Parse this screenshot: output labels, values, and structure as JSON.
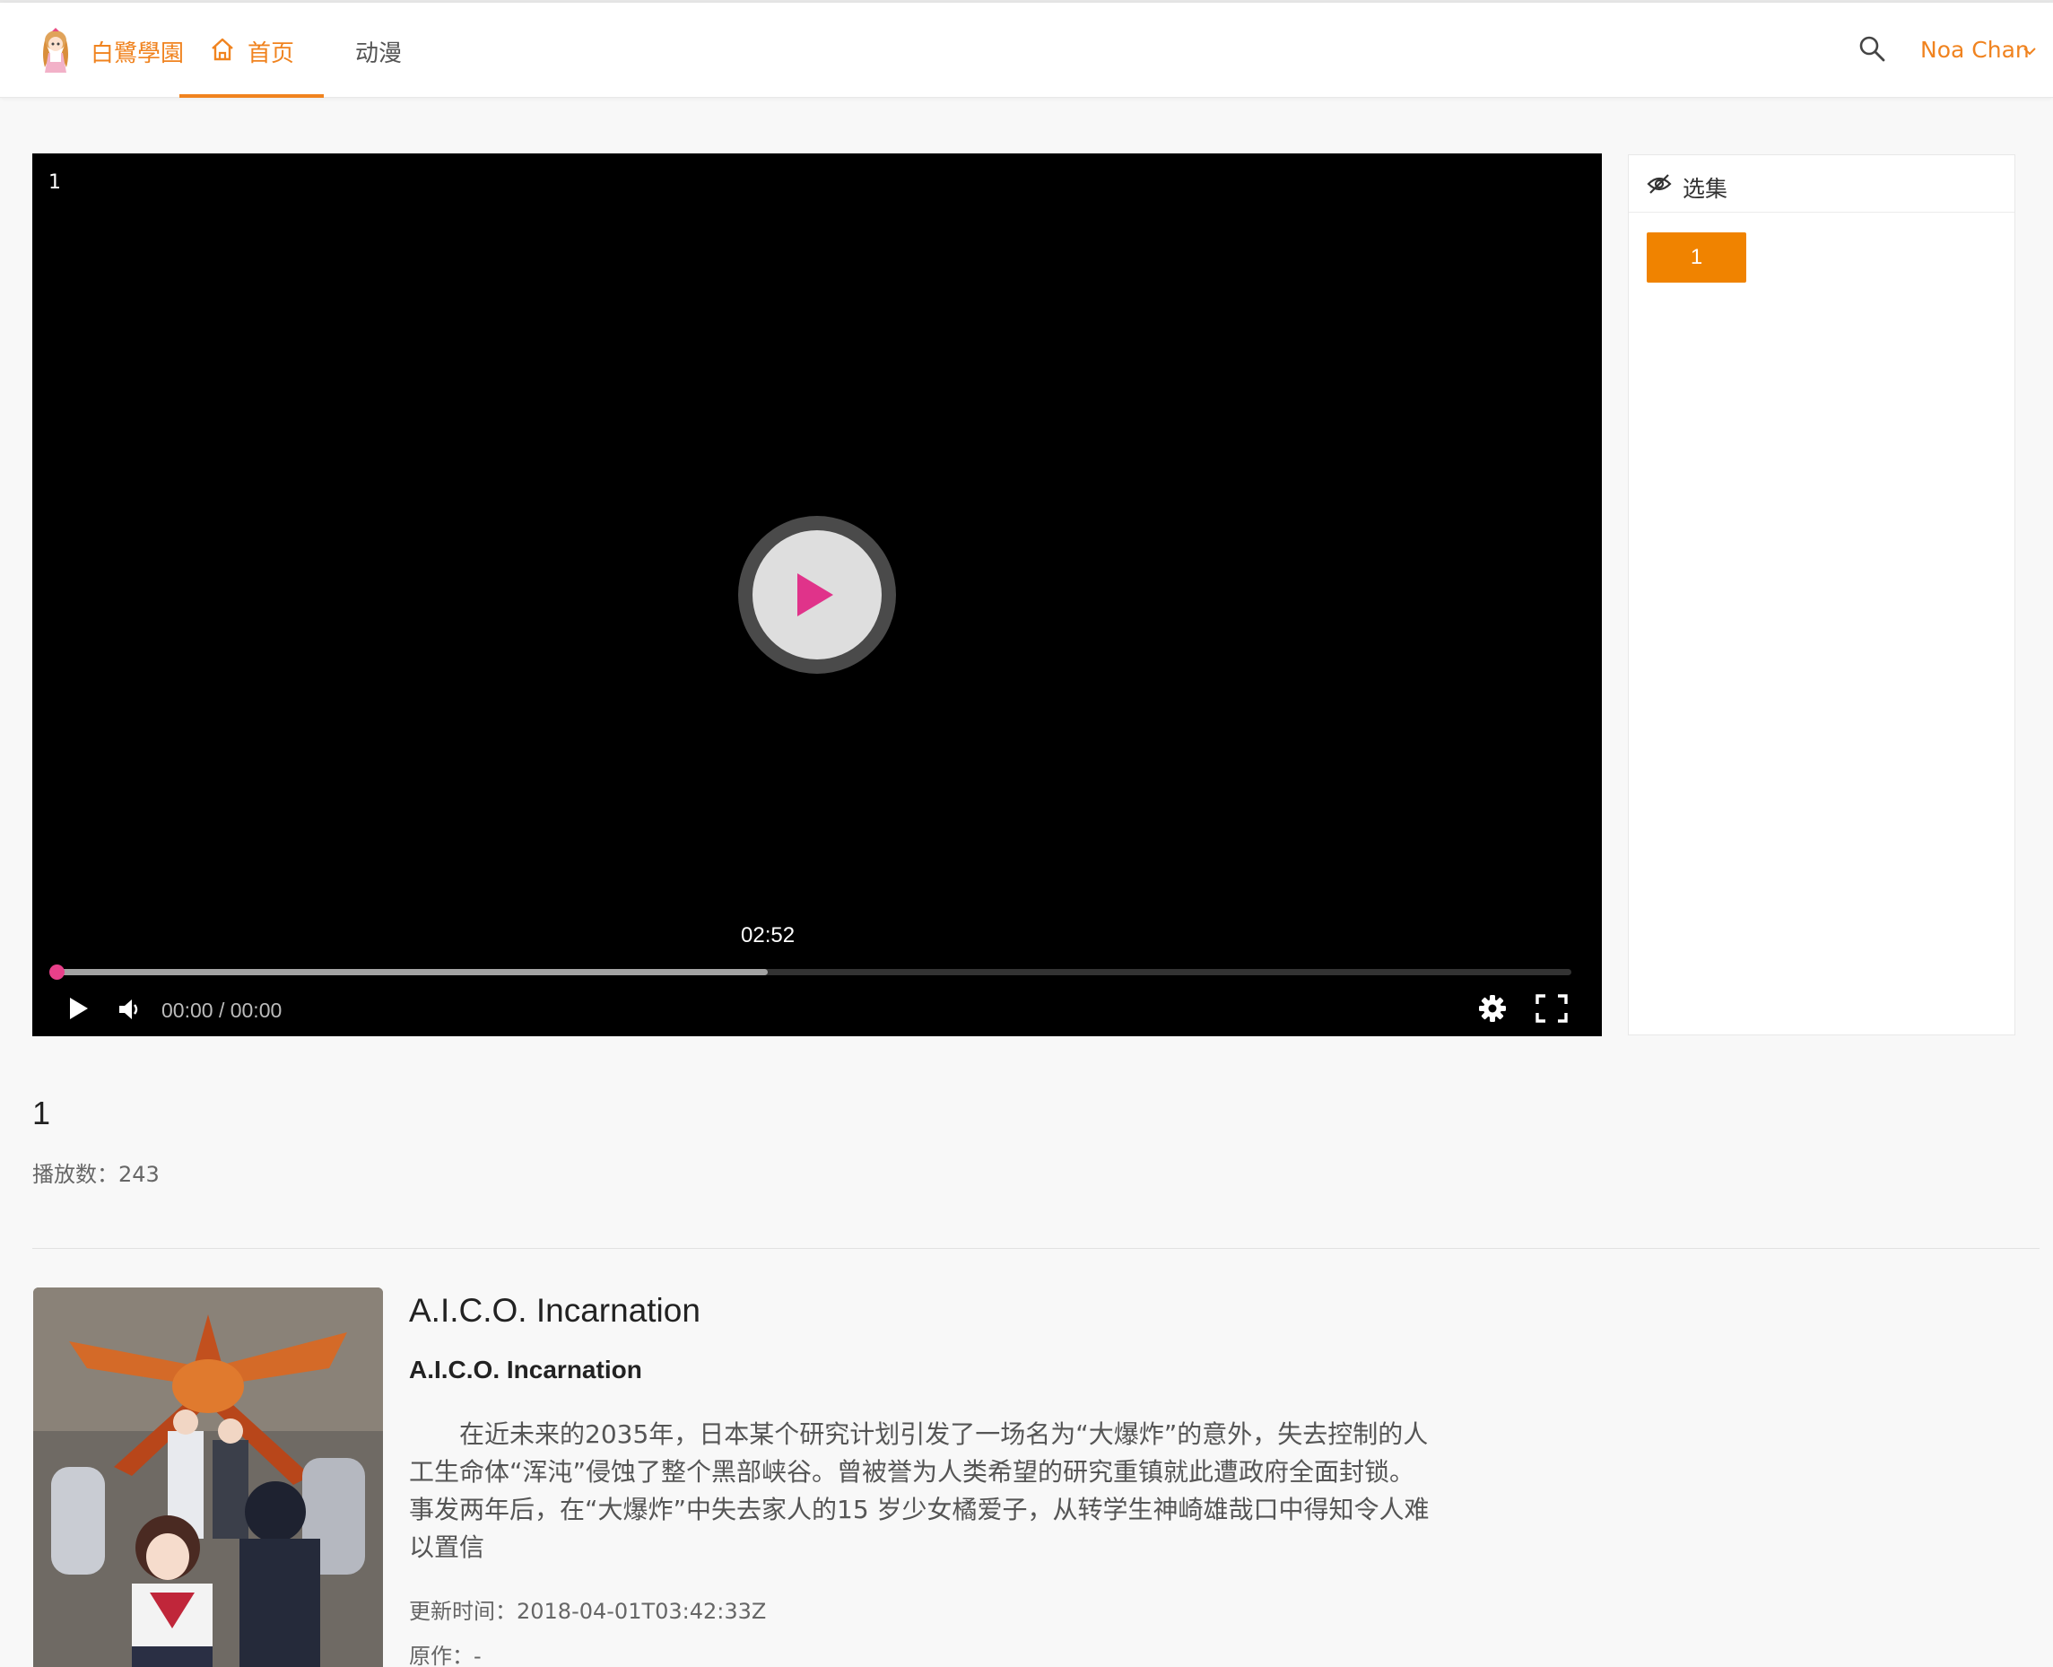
{
  "header": {
    "brand": "白鷺學園",
    "nav": {
      "home": "首页",
      "anime": "动漫"
    },
    "user": "Noa Chan",
    "accent": "#f0831f"
  },
  "player": {
    "title": "1",
    "hover_time": "02:52",
    "time_display": "00:00 / 00:00",
    "buffered_fraction": 0.47
  },
  "episodes": {
    "title": "选集",
    "items": [
      "1"
    ]
  },
  "episode": {
    "number": "1",
    "plays": "播放数：243"
  },
  "show": {
    "title": "A.I.C.O. Incarnation",
    "subtitle": "A.I.C.O. Incarnation",
    "description": "在近未来的2035年，日本某个研究计划引发了一场名为“大爆炸”的意外，失去控制的人工生命体“浑沌”侵蚀了整个黑部峡谷。曾被誉为人类希望的研究重镇就此遭政府全面封锁。事发两年后，在“大爆炸”中失去家人的15 岁少女橘爱子，从转学生神崎雄哉口中得知令人难以置信",
    "updated": "更新时间：2018-04-01T03:42:33Z",
    "original": "原作：-"
  }
}
